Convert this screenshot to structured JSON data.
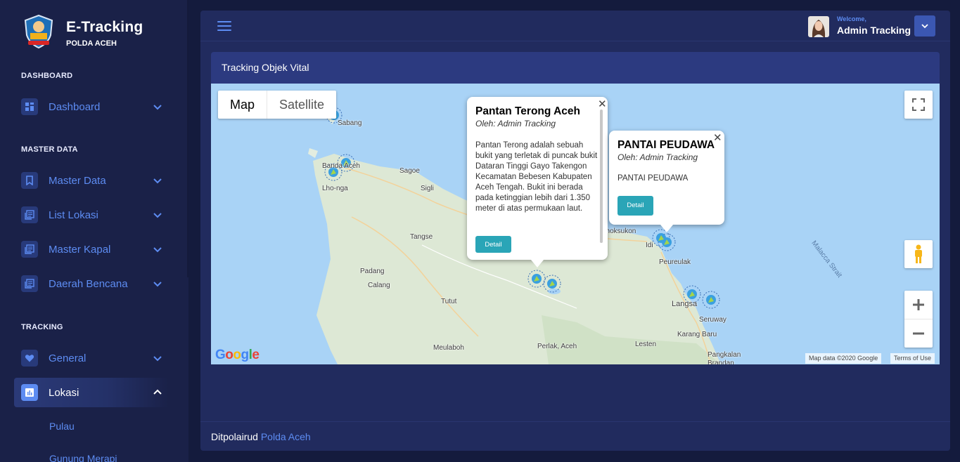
{
  "brand": {
    "title": "E-Tracking",
    "subtitle": "POLDA ACEH"
  },
  "sidebar": {
    "sections": [
      "DASHBOARD",
      "MASTER DATA",
      "TRACKING"
    ],
    "items": [
      {
        "label": "Dashboard",
        "icon": "dashboard-icon"
      },
      {
        "label": "Master Data",
        "icon": "bookmark-icon"
      },
      {
        "label": "List Lokasi",
        "icon": "list-icon"
      },
      {
        "label": "Master Kapal",
        "icon": "list-icon"
      },
      {
        "label": "Daerah Bencana",
        "icon": "list-icon"
      },
      {
        "label": "General",
        "icon": "heart-icon"
      },
      {
        "label": "Lokasi",
        "icon": "chart-icon"
      }
    ],
    "subitems": [
      "Pulau",
      "Gunung Merapi"
    ]
  },
  "header": {
    "welcome": "Welcome,",
    "user": "Admin Tracking"
  },
  "card": {
    "title": "Tracking Objek Vital"
  },
  "map": {
    "type_map": "Map",
    "type_satellite": "Satellite",
    "places": [
      "Sabang",
      "Banda Aceh",
      "Lho-nga",
      "Sagoe",
      "Sigli",
      "Tangse",
      "Padang",
      "Calang",
      "Tutut",
      "Meulaboh",
      "Perlak, Aceh",
      "Lesten",
      "Langsa",
      "Seruway",
      "Karang Baru",
      "Pangkalan Brandan",
      "Peureulak",
      "Idi",
      "Lhoksukon",
      "Malacca Strait"
    ],
    "attribution_data": "Map data ©2020 Google",
    "attribution_terms": "Terms of Use",
    "google": "Google"
  },
  "infowindows": [
    {
      "title": "Pantan Terong Aceh",
      "by": "Oleh: Admin Tracking",
      "body": "Pantan Terong adalah sebuah bukit yang terletak di puncak bukit Dataran Tinggi Gayo Takengon Kecamatan Bebesen Kabupaten Aceh Tengah. Bukit ini berada pada ketinggian lebih dari 1.350 meter di atas permukaan laut.",
      "button": "Detail"
    },
    {
      "title": "PANTAI PEUDAWA",
      "by": "Oleh: Admin Tracking",
      "body": "PANTAI PEUDAWA",
      "button": "Detail"
    }
  ],
  "footer": {
    "text": "Ditpolairud",
    "link": "Polda Aceh"
  },
  "colors": {
    "accent": "#5d8cf2",
    "sidebar": "#1a2148",
    "panel": "#212b5e",
    "button": "#2aa5b7"
  }
}
